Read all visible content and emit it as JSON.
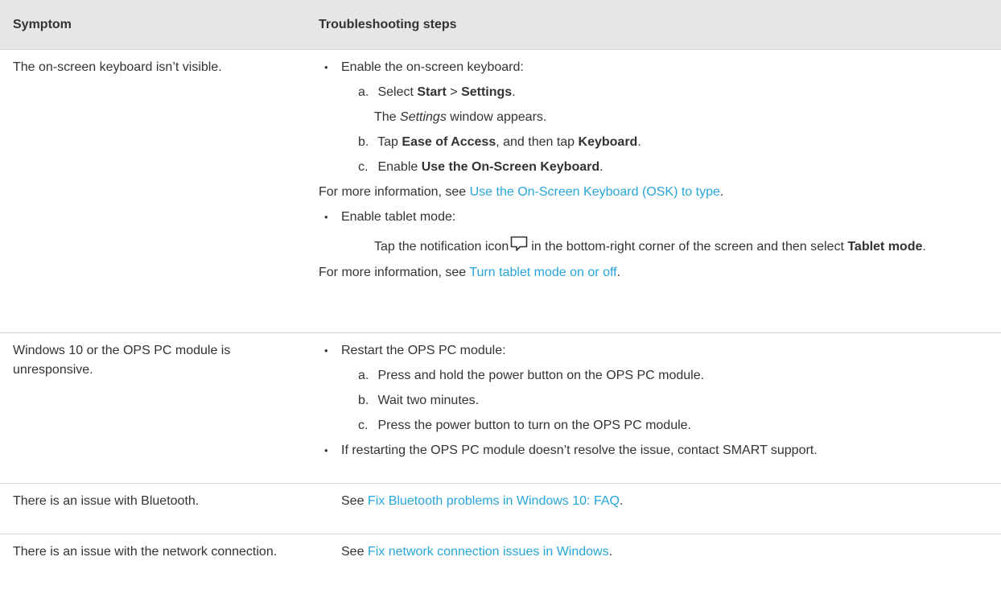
{
  "headers": {
    "symptom": "Symptom",
    "steps": "Troubleshooting steps"
  },
  "rows": [
    {
      "symptom": "The on-screen keyboard isn’t visible.",
      "bullet1": "Enable the on-screen keyboard:",
      "s_a": {
        "letter": "a.",
        "pre": "Select ",
        "b1": "Start",
        "mid": " > ",
        "b2": "Settings",
        "post": "."
      },
      "result": {
        "pre": "The ",
        "em": "Settings",
        "post": " window appears."
      },
      "s_b": {
        "letter": "b.",
        "pre": "Tap ",
        "b1": "Ease of Access",
        "mid": ", and then tap ",
        "b2": "Keyboard",
        "post": "."
      },
      "s_c": {
        "letter": "c.",
        "pre": "Enable ",
        "b1": "Use the On-Screen Keyboard",
        "post": "."
      },
      "more1": {
        "pre": "For more information, see ",
        "link": "Use the On-Screen Keyboard (OSK) to type",
        "post": "."
      },
      "bullet2": "Enable tablet mode:",
      "tap": {
        "pre": "Tap the notification icon",
        "post": "in the bottom-right corner of the screen and then select ",
        "b": "Tablet mode",
        "end": "."
      },
      "more2": {
        "pre": "For more information, see ",
        "link": "Turn tablet mode on or off",
        "post": "."
      }
    },
    {
      "symptom": "Windows 10 or the OPS PC module is unresponsive.",
      "bullet1": "Restart the OPS PC module:",
      "s_a": {
        "letter": "a.",
        "text": "Press and hold the power button on the OPS PC module."
      },
      "s_b": {
        "letter": "b.",
        "text": "Wait two minutes."
      },
      "s_c": {
        "letter": "c.",
        "text": "Press the power button to turn on the OPS PC module."
      },
      "bullet2": "If restarting the OPS PC module doesn’t resolve the issue, contact SMART support."
    },
    {
      "symptom": "There is an issue with Bluetooth.",
      "pre": "See ",
      "link": "Fix Bluetooth problems in Windows 10: FAQ",
      "post": "."
    },
    {
      "symptom": "There is an issue with the network connection.",
      "pre": "See ",
      "link": "Fix network connection issues in Windows",
      "post": "."
    }
  ],
  "icons": {
    "notification": "notification-icon"
  },
  "colors": {
    "link": "#27a5d8",
    "header_bg": "#e6e6e6",
    "text": "#333333"
  }
}
